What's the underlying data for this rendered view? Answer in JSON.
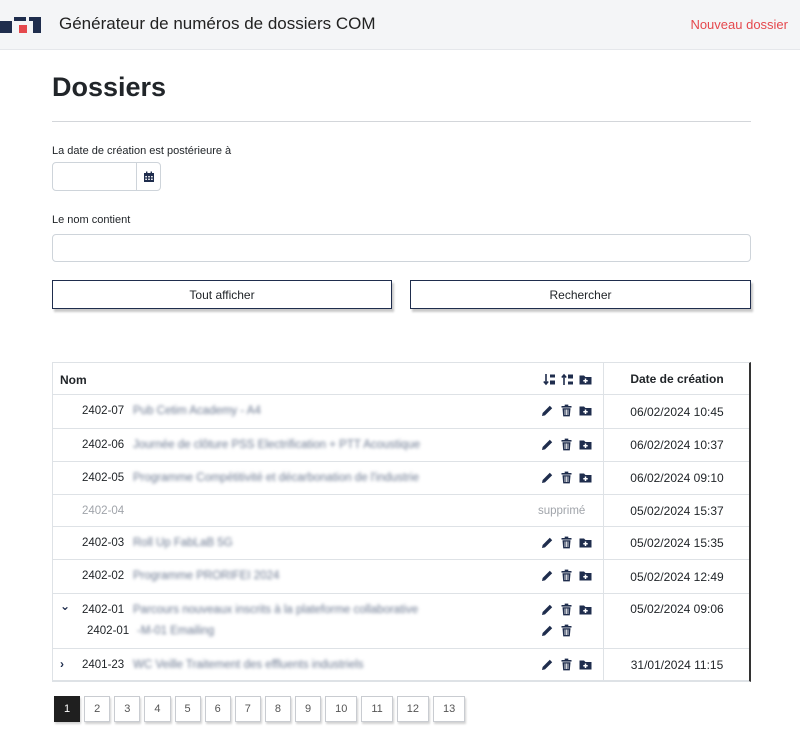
{
  "header": {
    "title": "Générateur de numéros de dossiers COM",
    "new_link": "Nouveau dossier"
  },
  "page": {
    "title": "Dossiers"
  },
  "filters": {
    "date_label": "La date de création est postérieure à",
    "date_value": "",
    "name_label": "Le nom contient",
    "name_value": "",
    "show_all": "Tout afficher",
    "search": "Rechercher"
  },
  "table": {
    "col_name": "Nom",
    "col_date": "Date de création",
    "rows": [
      {
        "num": "2402-07",
        "desc": "Pub Cetim Academy - A4",
        "date": "06/02/2024 10:45"
      },
      {
        "num": "2402-06",
        "desc": "Journée de clôture PSS Electrification + PTT Acoustique",
        "date": "06/02/2024 10:37"
      },
      {
        "num": "2402-05",
        "desc": "Programme Compétitivité et décarbonation de l'industrie",
        "date": "06/02/2024 09:10"
      },
      {
        "num": "2402-04",
        "desc": "",
        "status": "supprimé",
        "date": "05/02/2024 15:37"
      },
      {
        "num": "2402-03",
        "desc": "Roll Up FabLaB 5G",
        "date": "05/02/2024 15:35"
      },
      {
        "num": "2402-02",
        "desc": "Programme PRORIFEI 2024",
        "date": "05/02/2024 12:49"
      },
      {
        "num": "2402-01",
        "desc": "Parcours nouveaux inscrits à la plateforme collaborative",
        "date": "05/02/2024 09:06",
        "chevron": "⌄",
        "child": {
          "num": "2402-01",
          "desc": "-M-01      Emailing"
        }
      },
      {
        "num": "2401-23",
        "desc": "WC Veille Traitement des effluents industriels",
        "date": "31/01/2024 11:15",
        "chevron": "›"
      }
    ]
  },
  "pagination": {
    "pages": [
      "1",
      "2",
      "3",
      "4",
      "5",
      "6",
      "7",
      "8",
      "9",
      "10",
      "11",
      "12",
      "13"
    ],
    "active": "1"
  },
  "colors": {
    "accent": "#1f2d4d",
    "link_red": "#e5484d",
    "logo_red": "#e5484d",
    "logo_blue": "#1f2d4d"
  }
}
